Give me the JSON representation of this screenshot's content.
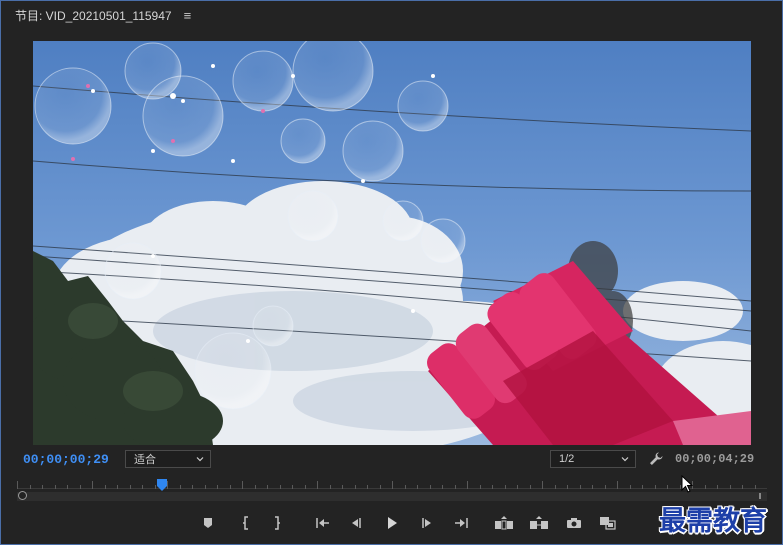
{
  "panel": {
    "title": "节目: VID_20210501_115947",
    "menu_icon": "hamburger-menu-icon"
  },
  "preview": {
    "description_icon": "video-frame"
  },
  "controls": {
    "current_timecode": "00;00;00;29",
    "fit_value": "适合",
    "resolution_value": "1/2",
    "settings_icon": "wrench-icon",
    "duration_timecode": "00;00;04;29"
  },
  "timeline": {
    "playhead_position_fraction": 0.193
  },
  "transport": {
    "buttons": [
      {
        "name": "add-marker-button",
        "icon": "marker-icon"
      },
      {
        "name": "mark-in-button",
        "icon": "mark-in-icon"
      },
      {
        "name": "mark-out-button",
        "icon": "mark-out-icon"
      },
      {
        "name": "go-to-in-button",
        "icon": "go-to-in-icon"
      },
      {
        "name": "step-back-button",
        "icon": "step-back-icon"
      },
      {
        "name": "play-button",
        "icon": "play-icon"
      },
      {
        "name": "step-forward-button",
        "icon": "step-forward-icon"
      },
      {
        "name": "go-to-out-button",
        "icon": "go-to-out-icon"
      },
      {
        "name": "lift-button",
        "icon": "lift-icon"
      },
      {
        "name": "extract-button",
        "icon": "extract-icon"
      },
      {
        "name": "export-frame-button",
        "icon": "camera-icon"
      },
      {
        "name": "compare-view-button",
        "icon": "compare-icon"
      }
    ]
  },
  "watermark": {
    "text": "最需教育"
  },
  "colors": {
    "accent_blue": "#3f8ff5",
    "panel_bg": "#232323",
    "border": "#4a6ea8"
  }
}
